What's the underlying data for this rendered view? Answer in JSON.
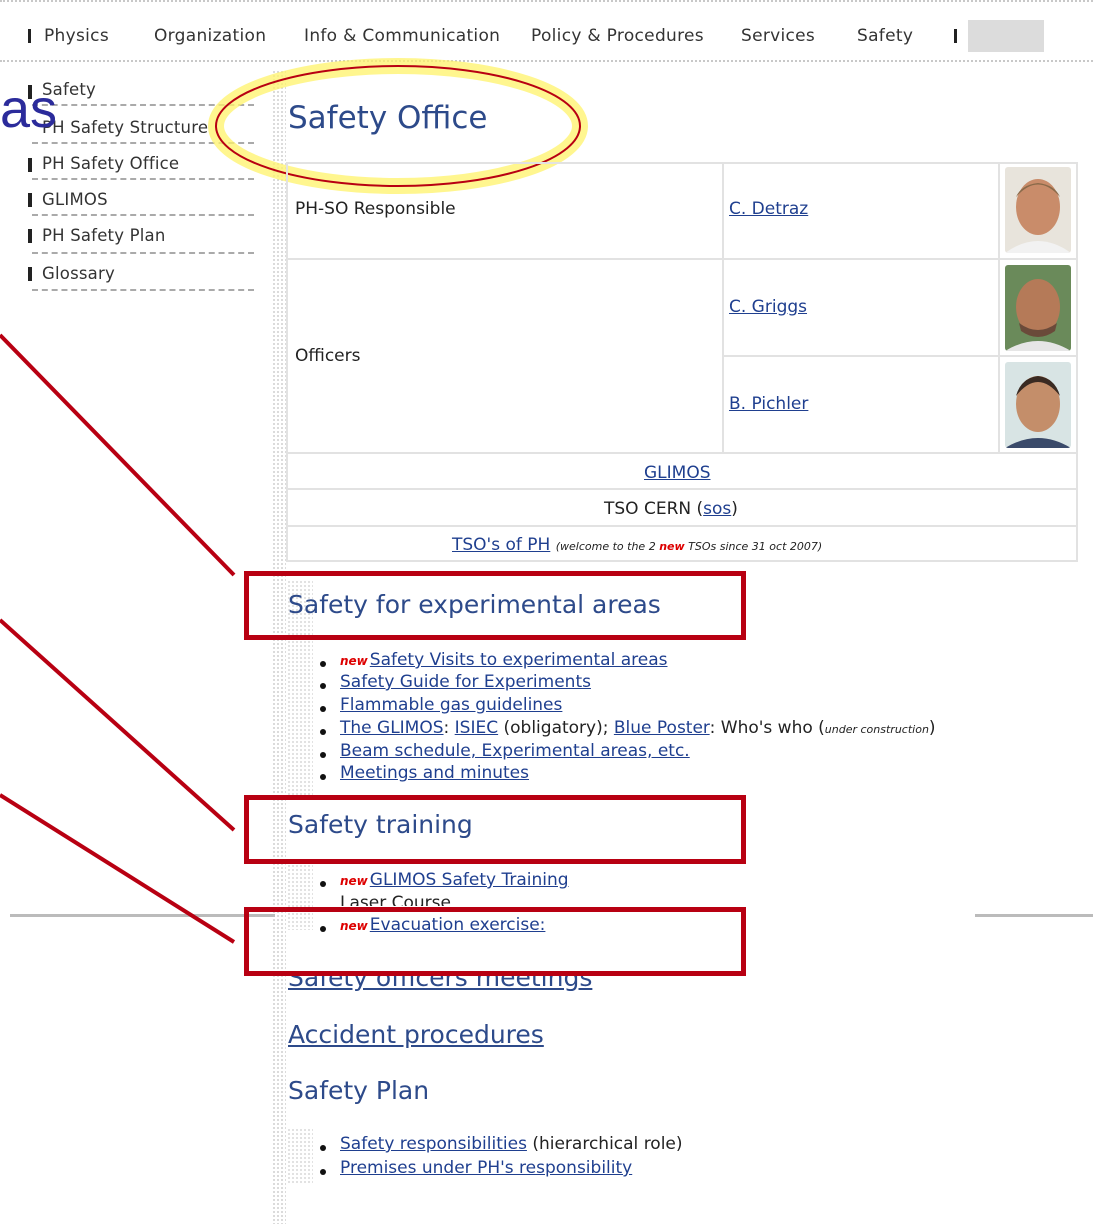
{
  "topnav": {
    "items": [
      "Physics",
      "Organization",
      "Info & Communication",
      "Policy & Procedures",
      "Services",
      "Safety"
    ]
  },
  "slide_fragment": "as",
  "leftmenu": {
    "items": [
      "Safety",
      "PH Safety Structure",
      "PH Safety Office",
      "GLIMOS",
      "PH Safety Plan",
      "Glossary"
    ]
  },
  "page_title": "Safety Office",
  "office_table": {
    "responsible_label": "PH-SO Responsible",
    "responsible_name": "C. Detraz",
    "officers_label": "Officers",
    "officer1": "C. Griggs",
    "officer2": "B. Pichler",
    "glimos_link": "GLIMOS",
    "tso_cern": "TSO CERN (",
    "tso_cern_link": "sos",
    "tso_cern_end": ")",
    "tso_ph_link": "TSO's of PH",
    "tso_ph_note_pre": "(welcome to the 2 ",
    "tso_ph_note_new": "new",
    "tso_ph_note_post": " TSOs since 31 oct 2007)"
  },
  "new_tag": "new",
  "section_experimental": {
    "title": "Safety for experimental areas",
    "items": {
      "visits": "Safety Visits to experimental areas",
      "guide": "Safety Guide for Experiments",
      "gas": "Flammable gas guidelines",
      "glimos": "The GLIMOS",
      "sep1": ": ",
      "isiec": "ISIEC",
      "obligatory": " (obligatory); ",
      "poster": "Blue Poster",
      "whos": ": Who's who (",
      "construction": "under construction",
      "close": ")",
      "beam": "Beam schedule, Experimental areas, etc.",
      "meetings": "Meetings and minutes"
    }
  },
  "section_training": {
    "title": "Safety training",
    "items": {
      "glimos_training": "GLIMOS Safety Training",
      "laser": "Laser Course",
      "evacuation": "Evacuation exercise:"
    }
  },
  "section_officers_meetings": "Safety officers meetings",
  "section_accident": "Accident procedures",
  "section_plan": {
    "title": "Safety Plan",
    "items": {
      "responsibilities": "Safety responsibilities",
      "hier": " (hierarchical role)",
      "premises": "Premises under PH's responsibility"
    }
  },
  "colors": {
    "annotation_red": "#b80012",
    "highlight_yellow": "#fff36a",
    "link_blue": "#1f3f8f",
    "heading_blue": "#2d4a8a"
  }
}
